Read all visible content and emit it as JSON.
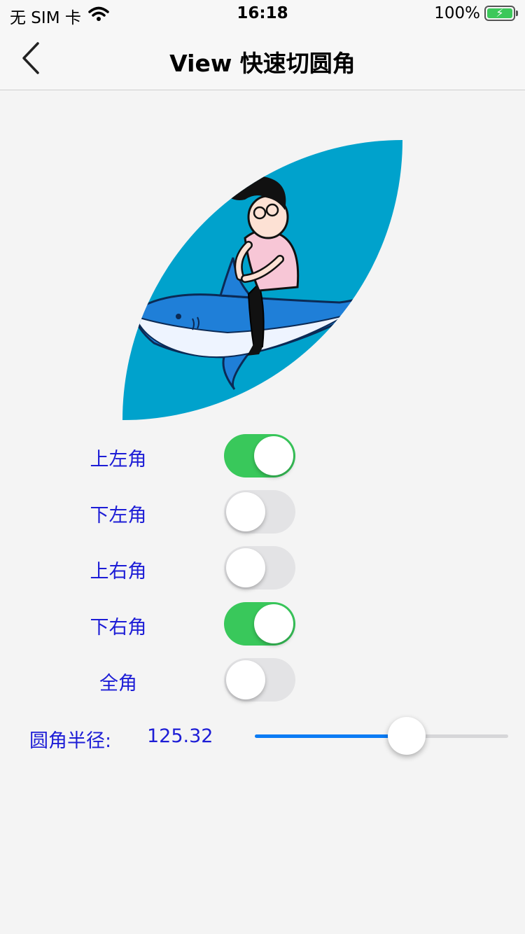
{
  "status_bar": {
    "carrier": "无 SIM 卡",
    "time": "16:18",
    "battery": "100%"
  },
  "nav": {
    "title": "View 快速切圆角"
  },
  "corners": [
    {
      "label": "上左角",
      "on": true
    },
    {
      "label": "下左角",
      "on": false
    },
    {
      "label": "上右角",
      "on": false
    },
    {
      "label": "下右角",
      "on": true
    },
    {
      "label": "全角",
      "on": false
    }
  ],
  "radius": {
    "label": "圆角半径:",
    "value": "125.32",
    "fraction": 0.6
  },
  "colors": {
    "switch_on": "#39c85b",
    "label_blue": "#1d1dd6",
    "image_bg": "#00a2cc",
    "slider_fill": "#0a7bf4"
  }
}
